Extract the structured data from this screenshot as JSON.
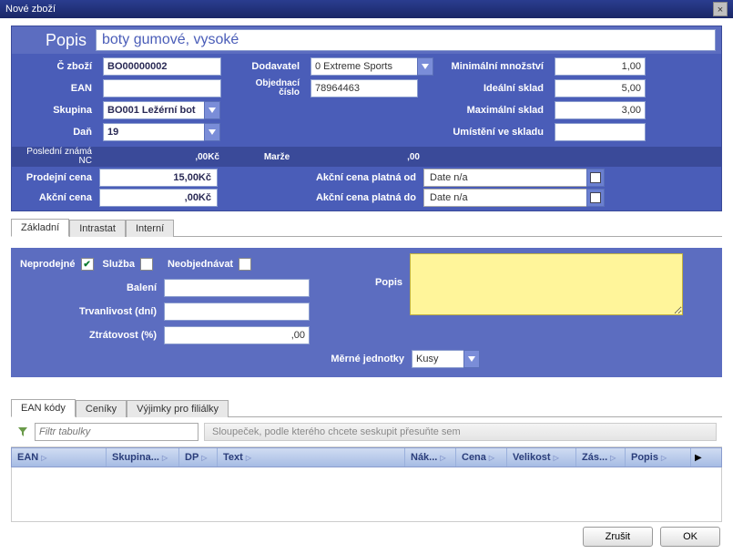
{
  "window": {
    "title": "Nové zboží"
  },
  "popis": {
    "label": "Popis",
    "value": "boty gumové, vysoké"
  },
  "form": {
    "czbozi": {
      "label": "Č zboží",
      "value": "BO00000002"
    },
    "ean": {
      "label": "EAN",
      "value": ""
    },
    "skupina": {
      "label": "Skupina",
      "value": "BO001 Ležérní bot"
    },
    "dan": {
      "label": "Daň",
      "value": "19"
    },
    "dodavatel": {
      "label": "Dodavatel",
      "value": "0 Extreme Sports"
    },
    "objednaci": {
      "label": "Objednací číslo",
      "value": "78964463"
    },
    "minmnoz": {
      "label": "Minimální množství",
      "value": "1,00"
    },
    "idealni": {
      "label": "Ideální  sklad",
      "value": "5,00"
    },
    "maximal": {
      "label": "Maximální sklad",
      "value": "3,00"
    },
    "umisteni": {
      "label": "Umístění ve skladu",
      "value": ""
    }
  },
  "prices": {
    "posledni_nc_label": "Poslední známá NC",
    "posledni_nc_val": ",00Kč",
    "marze_label": "Marže",
    "marze_val": ",00",
    "prodejni_label": "Prodejní cena",
    "prodejni_val": "15,00Kč",
    "akcni_od_label": "Akční cena platná od",
    "akcni_od_val": "Date n/a",
    "akcni_label": "Akční cena",
    "akcni_val": ",00Kč",
    "akcni_do_label": "Akční cena platná do",
    "akcni_do_val": "Date n/a"
  },
  "tabs_upper": [
    "Základní",
    "Intrastat",
    "Interní"
  ],
  "middle": {
    "neprodejne": "Neprodejné",
    "sluzba": "Služba",
    "neobjednavat": "Neobjednávat",
    "baleni": {
      "label": "Balení",
      "value": ""
    },
    "trvanlivost": {
      "label": "Trvanlivost (dní)",
      "value": ""
    },
    "ztratovost": {
      "label": "Ztrátovost (%)",
      "value": ",00"
    },
    "popis": {
      "label": "Popis",
      "value": ""
    },
    "merne": {
      "label": "Měrné jednotky",
      "value": "Kusy"
    }
  },
  "tabs_lower": [
    "EAN kódy",
    "Ceníky",
    "Výjimky pro filiálky"
  ],
  "grid": {
    "filter_placeholder": "Filtr tabulky",
    "group_hint": "Sloupeček, podle kterého chcete seskupit přesuňte sem",
    "columns": [
      "EAN",
      "Skupina...",
      "DP",
      "Text",
      "Nák...",
      "Cena",
      "Velikost",
      "Zás...",
      "Popis"
    ]
  },
  "footer": {
    "cancel": "Zrušit",
    "ok": "OK"
  }
}
